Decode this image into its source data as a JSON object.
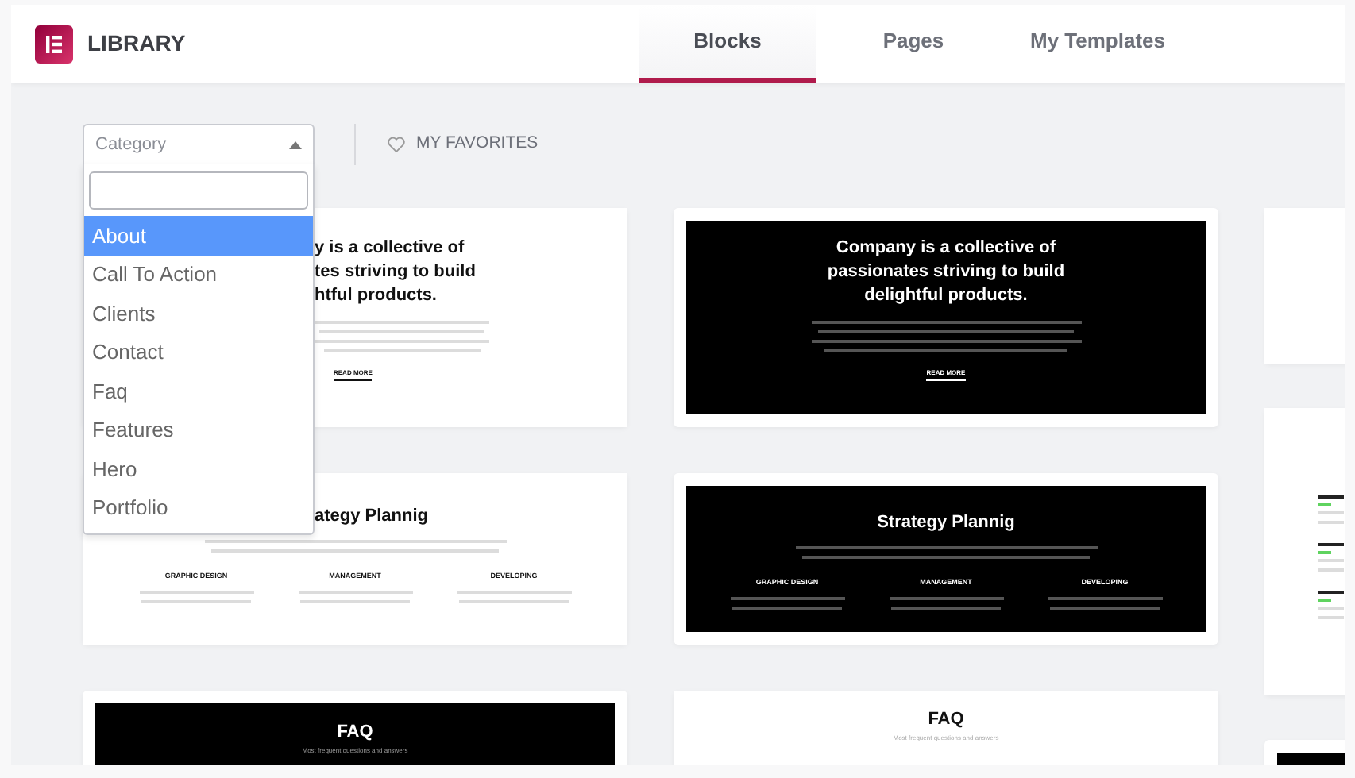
{
  "header": {
    "title": "LIBRARY",
    "tabs": [
      {
        "label": "Blocks",
        "selected": true
      },
      {
        "label": "Pages",
        "selected": false
      },
      {
        "label": "My Templates",
        "selected": false
      }
    ]
  },
  "toolbar": {
    "category": {
      "placeholder": "Category",
      "expanded": true
    },
    "favorites": "MY FAVORITES"
  },
  "dropdown": {
    "options": [
      {
        "label": "About",
        "selected": true
      },
      {
        "label": "Call To Action",
        "selected": false
      },
      {
        "label": "Clients",
        "selected": false
      },
      {
        "label": "Contact",
        "selected": false
      },
      {
        "label": "Faq",
        "selected": false
      },
      {
        "label": "Features",
        "selected": false
      },
      {
        "label": "Hero",
        "selected": false
      },
      {
        "label": "Portfolio",
        "selected": false
      }
    ]
  },
  "columns": [
    [
      {
        "kind": "about",
        "dark": false,
        "heading_lines": [
          "y is a collective of",
          "tes striving to build",
          "htful products."
        ],
        "button": "READ MORE"
      },
      {
        "kind": "services",
        "dark": false,
        "heading": "ategy Plannig",
        "features": [
          "GRAPHIC DESIGN",
          "MANAGEMENT",
          "DEVELOPING"
        ]
      },
      {
        "kind": "faq",
        "dark": true,
        "heading": "FAQ",
        "subtitle": "Most frequent questions and answers"
      }
    ],
    [
      {
        "kind": "about",
        "dark": true,
        "heading_lines": [
          "Company is a collective of",
          "passionates striving to build",
          "delightful products."
        ],
        "button": "READ MORE"
      },
      {
        "kind": "services",
        "dark": true,
        "heading": "Strategy Plannig",
        "features": [
          "GRAPHIC DESIGN",
          "MANAGEMENT",
          "DEVELOPING"
        ]
      },
      {
        "kind": "faq",
        "dark": false,
        "heading": "FAQ",
        "subtitle": "Most frequent questions and answers"
      }
    ],
    [
      {
        "kind": "blank",
        "dark": false
      },
      {
        "kind": "questions",
        "dark": false
      },
      {
        "kind": "blank",
        "dark": true
      }
    ]
  ]
}
